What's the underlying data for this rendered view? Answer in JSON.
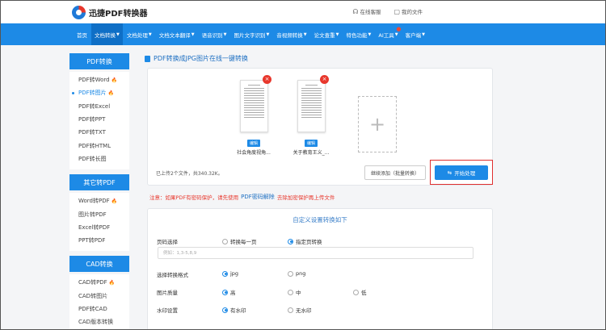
{
  "header": {
    "logo_text": "迅捷PDF转换器",
    "service_label": "在线客服",
    "files_label": "我的文件"
  },
  "nav": [
    {
      "label": "首页",
      "caret": false
    },
    {
      "label": "文档转换",
      "caret": true,
      "active": true
    },
    {
      "label": "文档处理",
      "caret": true
    },
    {
      "label": "文档文本翻译",
      "caret": true
    },
    {
      "label": "语音识别",
      "caret": true
    },
    {
      "label": "图片文字识别",
      "caret": true
    },
    {
      "label": "音视频转换",
      "caret": true
    },
    {
      "label": "论文查重",
      "caret": true
    },
    {
      "label": "特色功能",
      "caret": true
    },
    {
      "label": "AI工具",
      "caret": true,
      "dot": true
    },
    {
      "label": "客户端",
      "caret": true
    }
  ],
  "sidebar": {
    "groups": [
      {
        "title": "PDF转换",
        "items": [
          {
            "label": "PDF转Word",
            "hot": true
          },
          {
            "label": "PDF转图片",
            "hot": true,
            "active": true
          },
          {
            "label": "PDF转Excel"
          },
          {
            "label": "PDF转PPT"
          },
          {
            "label": "PDF转TXT"
          },
          {
            "label": "PDF转HTML"
          },
          {
            "label": "PDF转长图"
          }
        ]
      },
      {
        "title": "其它转PDF",
        "items": [
          {
            "label": "Word转PDF",
            "hot": true
          },
          {
            "label": "图片转PDF"
          },
          {
            "label": "Excel转PDF"
          },
          {
            "label": "PPT转PDF"
          }
        ]
      },
      {
        "title": "CAD转换",
        "items": [
          {
            "label": "CAD转PDF",
            "hot": true
          },
          {
            "label": "CAD转图片"
          },
          {
            "label": "PDF转CAD"
          },
          {
            "label": "CAD版本转换"
          }
        ]
      }
    ]
  },
  "main": {
    "title": "PDF转换成JPG图片在线一键转换",
    "files": [
      {
        "name": "社会角度视角...",
        "tag": "编辑"
      },
      {
        "name": "关于教育王义_...",
        "tag": "编辑"
      }
    ],
    "summary": "已上传2个文件，共340.32K。",
    "continue_label": "继续添加（批量转换）",
    "start_label": "开始处理"
  },
  "notice": {
    "prefix": "注意：如果PDF有密码保护，请先使用",
    "link": "PDF密码解除",
    "suffix": "去除加密保护再上传文件"
  },
  "settings": {
    "title": "自定义设置转换如下",
    "page_select": {
      "label": "页码选择",
      "options": [
        "转换每一页",
        "指定页转换"
      ],
      "selected": 1,
      "placeholder": "例如：1,3-5,8,9"
    },
    "format": {
      "label": "选择转换格式",
      "options": [
        "jpg",
        "png"
      ],
      "selected": 0
    },
    "quality": {
      "label": "图片质量",
      "options": [
        "高",
        "中",
        "低"
      ],
      "selected": 0
    },
    "watermark": {
      "label": "水印设置",
      "options": [
        "有水印",
        "无水印"
      ],
      "selected": 0
    }
  }
}
